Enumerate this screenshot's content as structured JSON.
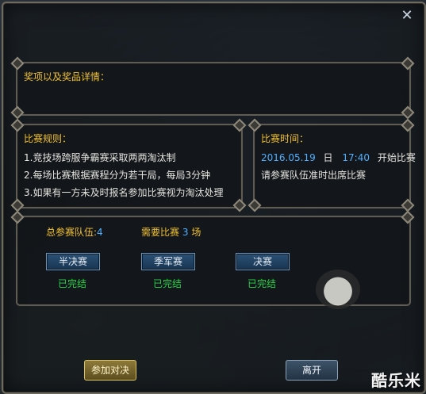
{
  "window": {
    "close_label": "✕"
  },
  "rewards": {
    "title": "奖项以及奖品详情："
  },
  "rules": {
    "title": "比赛规则：",
    "items": [
      "1.竞技场跨服争霸赛采取两两淘汰制",
      "2.每场比赛根据赛程分为若干局，每局3分钟",
      "3.如果有一方未及时报名参加比赛视为淘汰处理"
    ]
  },
  "schedule": {
    "title": "比赛时间：",
    "date": "2016.05.19",
    "day_label": "日",
    "time": "17:40",
    "start_label": "开始比赛",
    "notice": "请参赛队伍准时出席比赛"
  },
  "progress": {
    "teams_label": "总参赛队伍:",
    "teams_count": "4",
    "matches_label": "需要比赛",
    "matches_count": "3",
    "matches_unit": "场",
    "stages": [
      {
        "label": "半决赛",
        "status": "已完结"
      },
      {
        "label": "季军赛",
        "status": "已完结"
      },
      {
        "label": "决赛",
        "status": "已完结"
      }
    ]
  },
  "footer": {
    "join_label": "参加对决",
    "leave_label": "离开"
  },
  "watermark": "酷乐米",
  "colors": {
    "title_gold": "#f2c230",
    "accent_blue": "#4fb0ff",
    "status_green": "#28d34a"
  }
}
